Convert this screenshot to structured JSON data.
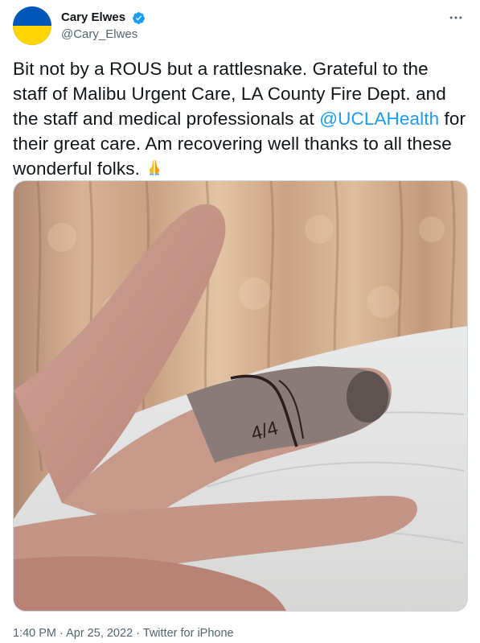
{
  "author": {
    "display_name": "Cary Elwes",
    "handle": "@Cary_Elwes",
    "verified": true,
    "avatar_colors": [
      "#0057b7",
      "#ffd500"
    ]
  },
  "more_icon": "more-horizontal-icon",
  "tweet": {
    "text_part1": "Bit not by a ROUS but a rattlesnake. Grateful to the staff of Malibu Urgent Care, LA County Fire Dept. and the staff and medical professionals at ",
    "mention": "@UCLAHealth",
    "text_part2": " for their great care. Am recovering well thanks to all these wonderful folks.",
    "emoji": "folded-hands-emoji"
  },
  "media": {
    "type": "photo",
    "handwriting": "4/4"
  },
  "footer": {
    "time": "1:40 PM",
    "separator1": " · ",
    "date": "Apr 25, 2022",
    "separator2": " · ",
    "source": "Twitter for iPhone"
  },
  "colors": {
    "link": "#1d9bf0",
    "secondary_text": "#536471",
    "verified": "#1d9bf0"
  }
}
